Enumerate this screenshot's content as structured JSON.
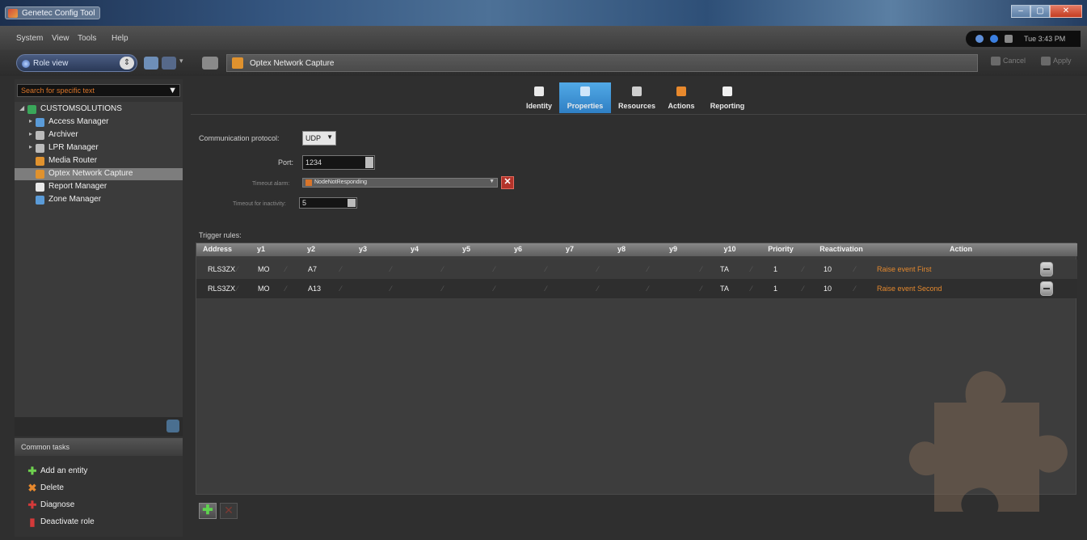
{
  "window": {
    "title": "Genetec Config Tool",
    "controls": [
      "–",
      "▢",
      "✕"
    ]
  },
  "menu": {
    "items": [
      "System",
      "View",
      "Tools",
      "Help"
    ]
  },
  "status": {
    "text": "Tue 3:43 PM"
  },
  "toolbar": {
    "view_label": "Role view",
    "address": "Optex Network Capture",
    "cancel_label": "Cancel",
    "apply_label": "Apply"
  },
  "sidebar": {
    "search_placeholder": "Search for specific text",
    "root_label": "CUSTOMSOLUTIONS",
    "items": [
      {
        "label": "Access Manager",
        "color": "#5a9bd8"
      },
      {
        "label": "Archiver",
        "color": "#bbbbbb"
      },
      {
        "label": "LPR Manager",
        "color": "#bbbbbb"
      },
      {
        "label": "Media Router",
        "color": "#e0922e"
      },
      {
        "label": "Optex Network Capture",
        "color": "#e0922e"
      },
      {
        "label": "Report Manager",
        "color": "#e9e9e9"
      },
      {
        "label": "Zone Manager",
        "color": "#5a9bd8"
      }
    ],
    "selected_index": 4
  },
  "tasks": {
    "title": "Common tasks",
    "items": [
      {
        "label": "Add an entity",
        "icon": "plus-icon",
        "glyph": "✚",
        "color": "#6fd24f"
      },
      {
        "label": "Delete",
        "icon": "delete-icon",
        "glyph": "✖",
        "color": "#e8892d"
      },
      {
        "label": "Diagnose",
        "icon": "diagnose-icon",
        "glyph": "✚",
        "color": "#d43a3a"
      },
      {
        "label": "Deactivate role",
        "icon": "deactivate-icon",
        "glyph": "▮",
        "color": "#d43a3a"
      }
    ]
  },
  "tabs": [
    {
      "label": "Identity",
      "icon": "identity-icon"
    },
    {
      "label": "Properties",
      "icon": "properties-icon"
    },
    {
      "label": "Resources",
      "icon": "resources-icon"
    },
    {
      "label": "Actions",
      "icon": "actions-icon"
    },
    {
      "label": "Reporting",
      "icon": "reporting-icon"
    }
  ],
  "active_tab": "Properties",
  "properties": {
    "protocol_label": "Communication protocol:",
    "protocol_value": "UDP",
    "port_label": "Port:",
    "port_value": "1234",
    "timeout_alarm_label": "Timeout alarm:",
    "timeout_alarm_value": "NodeNotResponding",
    "timeout_inactivity_label": "Timeout for inactivity:",
    "timeout_inactivity_value": "5"
  },
  "trigger_rules": {
    "title": "Trigger rules:",
    "columns": [
      "Address",
      "y1",
      "y2",
      "y3",
      "y4",
      "y5",
      "y6",
      "y7",
      "y8",
      "y9",
      "y10",
      "Priority",
      "Reactivation",
      "Action"
    ],
    "rows": [
      {
        "address": "RLS3ZX",
        "y1": "MO",
        "y2": "A7",
        "y10": "TA",
        "priority": "1",
        "reactivation": "10",
        "action": "Raise event First"
      },
      {
        "address": "RLS3ZX",
        "y1": "MO",
        "y2": "A13",
        "y10": "TA",
        "priority": "1",
        "reactivation": "10",
        "action": "Raise event Second"
      }
    ]
  },
  "colors": {
    "accent_tab": "#3d93d6",
    "action_text": "#e3882e",
    "placeholder": "#d9752a"
  }
}
